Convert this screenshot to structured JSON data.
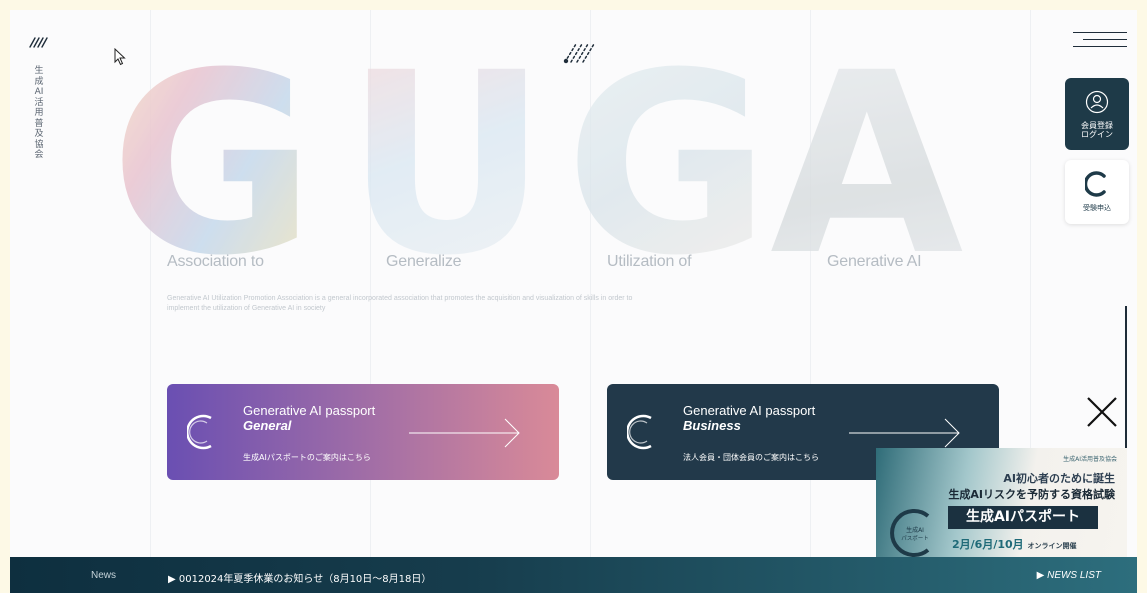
{
  "brand": {
    "vertical_name": "生成AI活用普及協会"
  },
  "hero": {
    "letters": [
      "G",
      "U",
      "G",
      "A"
    ],
    "tagline": [
      "Association to",
      "Generalize",
      "Utilization of",
      "Generative AI"
    ],
    "description": "Generative AI Utilization Promotion Association is a general incorporated association that promotes the acquisition and visualization of skills in order to implement the utilization of Generative AI in society"
  },
  "side": {
    "login_label_1": "会員登録",
    "login_label_2": "ログイン",
    "exam_label": "受験申込"
  },
  "cta": {
    "general": {
      "title": "Generative AI passport",
      "subtitle": "General",
      "caption": "生成AIパスポートのご案内はこちら"
    },
    "business": {
      "title": "Generative AI passport",
      "subtitle": "Business",
      "caption": "法人会員・団体会員のご案内はこちら"
    }
  },
  "banner": {
    "org": "生成AI活用普及協会",
    "line1": "AI初心者のために誕生",
    "line2": "生成AIリスクを予防する資格試験",
    "title": "生成AIパスポート",
    "schedule": "2月/6月/10月",
    "schedule_suffix": "オンライン開催",
    "emblem_text_1": "生成AI",
    "emblem_text_2": "パスポート"
  },
  "news": {
    "label": "News",
    "item": "▶ 0012024年夏季休業のお知らせ（8月10日〜8月18日）",
    "list_label": "▶ NEWS LIST"
  },
  "colors": {
    "dark_navy": "#1e3a48",
    "cta_purple": "#6a4fb2",
    "cta_pink": "#d98a98",
    "news_teal": "#2d6e7d"
  }
}
